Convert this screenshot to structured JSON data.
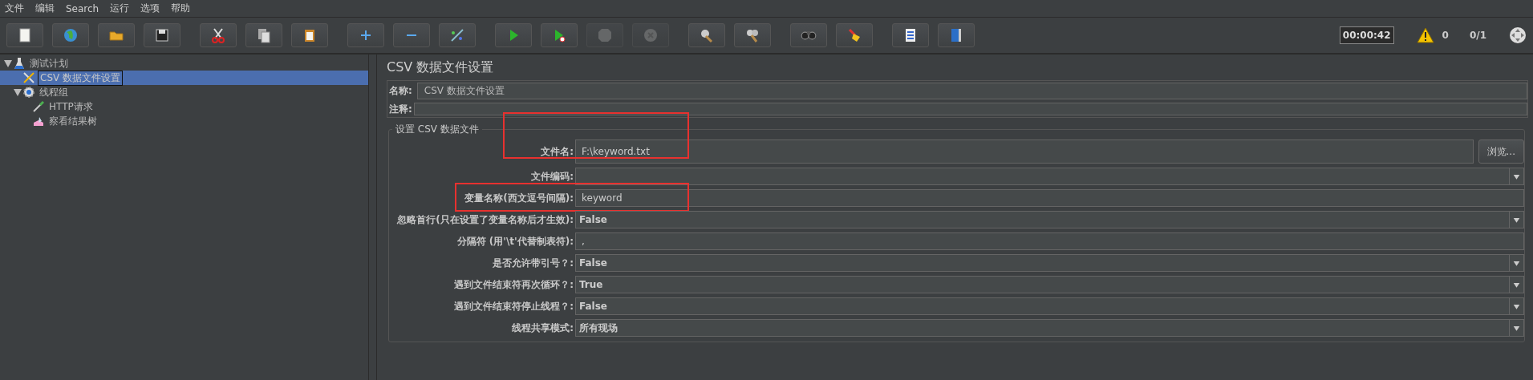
{
  "menu": [
    "文件",
    "编辑",
    "Search",
    "运行",
    "选项",
    "帮助"
  ],
  "toolbar": [
    {
      "kind": "new",
      "disabled": false
    },
    {
      "kind": "templates",
      "disabled": false
    },
    {
      "kind": "open",
      "disabled": false
    },
    {
      "kind": "save",
      "disabled": false
    },
    {
      "kind": "cut",
      "disabled": false
    },
    {
      "kind": "copy",
      "disabled": false
    },
    {
      "kind": "paste",
      "disabled": false
    },
    {
      "kind": "expand",
      "disabled": false
    },
    {
      "kind": "collapse",
      "disabled": false
    },
    {
      "kind": "toggle",
      "disabled": false
    },
    {
      "kind": "start",
      "disabled": false
    },
    {
      "kind": "start-no-pause",
      "disabled": false
    },
    {
      "kind": "stop",
      "disabled": true
    },
    {
      "kind": "shutdown",
      "disabled": true
    },
    {
      "kind": "clear",
      "disabled": false
    },
    {
      "kind": "clear-all",
      "disabled": false
    },
    {
      "kind": "search",
      "disabled": false
    },
    {
      "kind": "reset-search",
      "disabled": false
    },
    {
      "kind": "functions",
      "disabled": false
    },
    {
      "kind": "help",
      "disabled": false
    }
  ],
  "status": {
    "timer": "00:00:42",
    "warnings": "0",
    "threads": "0/1"
  },
  "tree": [
    {
      "label": "测试计划",
      "kind": "plan",
      "selected": false,
      "expanded": true,
      "children": [
        {
          "label": "CSV 数据文件设置",
          "kind": "config",
          "selected": true
        },
        {
          "label": "线程组",
          "kind": "thread-group",
          "selected": false,
          "expanded": true,
          "children": [
            {
              "label": "HTTP请求",
              "kind": "sampler",
              "selected": false
            },
            {
              "label": "察看结果树",
              "kind": "listener",
              "selected": false
            }
          ]
        }
      ]
    }
  ],
  "panel": {
    "title": "CSV 数据文件设置",
    "name": {
      "label": "名称:",
      "value": "CSV 数据文件设置"
    },
    "comment": {
      "label": "注释:"
    },
    "group_title": "设置 CSV 数据文件",
    "fields": [
      {
        "label": "文件名:",
        "value": "F:\\keyword.txt",
        "kind": "text",
        "highlighted": true,
        "button": "浏览..."
      },
      {
        "label": "文件编码:",
        "kind": "dropdown"
      },
      {
        "label": "变量名称(西文逗号间隔):",
        "value": "keyword",
        "kind": "text",
        "highlighted": true
      },
      {
        "label": "忽略首行(只在设置了变量名称后才生效):",
        "value": "False",
        "kind": "dropdown"
      },
      {
        "label": "分隔符 (用'\\t'代替制表符):",
        "value": ",",
        "kind": "text"
      },
      {
        "label": "是否允许带引号？:",
        "value": "False",
        "kind": "dropdown"
      },
      {
        "label": "遇到文件结束符再次循环？:",
        "value": "True",
        "kind": "dropdown"
      },
      {
        "label": "遇到文件结束符停止线程？:",
        "value": "False",
        "kind": "dropdown"
      },
      {
        "label": "线程共享模式:",
        "value": "所有现场",
        "kind": "dropdown"
      }
    ]
  }
}
